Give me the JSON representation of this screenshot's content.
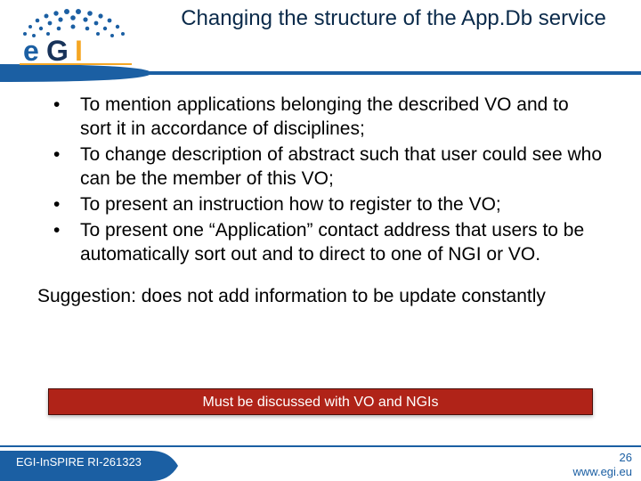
{
  "logo": {
    "name": "egi"
  },
  "title": "Changing the structure of the App.Db service",
  "bullets": [
    "To mention applications belonging the described VO and to sort it in accordance of disciplines;",
    "To change description of abstract such that user could see who can be the member of this VO;",
    "To present an instruction how to register to the VO;",
    "To present one “Application” contact address that users to be automatically sort out and to direct to one of NGI or VO."
  ],
  "suggestion": "Suggestion: does not add information to be update constantly",
  "banner": "Must be discussed with VO and NGIs",
  "footer": {
    "left": "EGI-InSPIRE RI-261323",
    "page": "26",
    "url": "www.egi.eu"
  },
  "colors": {
    "navy": "#0a2a4a",
    "blue": "#1b5fa3",
    "red": "#b02318"
  }
}
